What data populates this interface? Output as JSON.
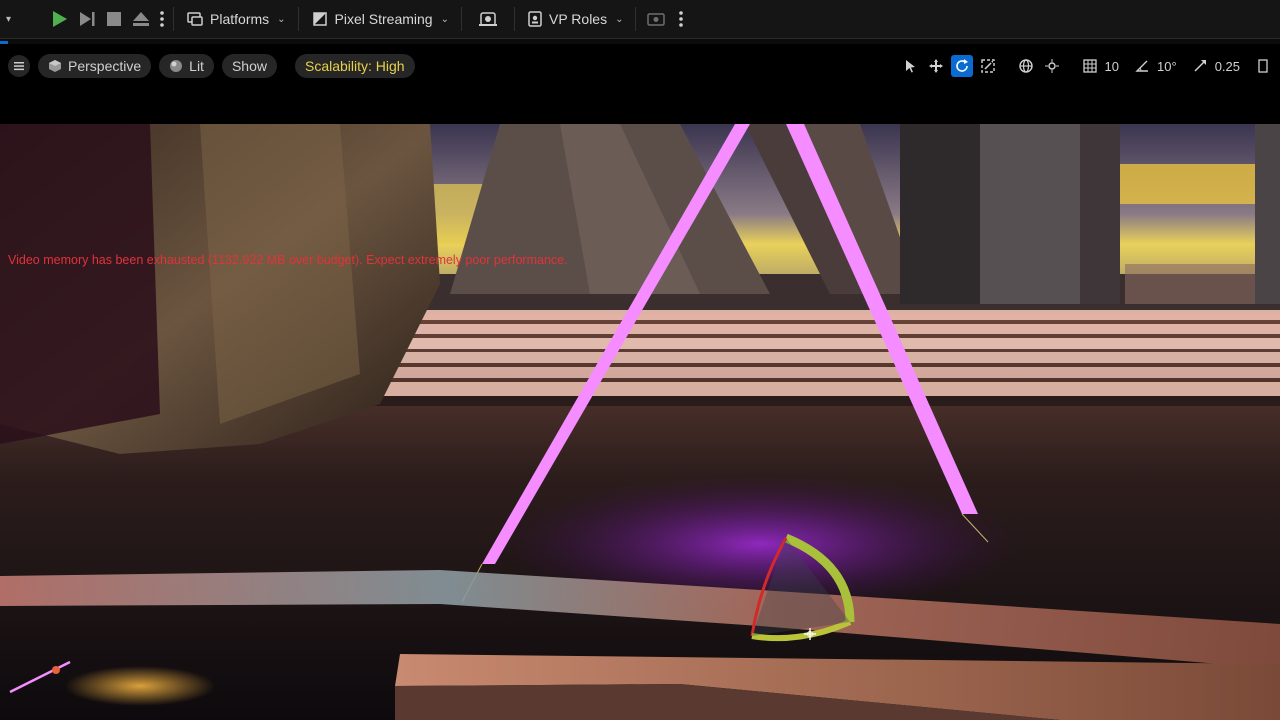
{
  "toolbar": {
    "platforms_label": "Platforms",
    "pixel_streaming_label": "Pixel Streaming",
    "vp_roles_label": "VP Roles"
  },
  "viewport_bar": {
    "perspective_label": "Perspective",
    "lit_label": "Lit",
    "show_label": "Show",
    "scalability_label": "Scalability: High",
    "grid_value": "10",
    "angle_value": "10°",
    "scale_value": "0.25"
  },
  "viewport": {
    "warning": "Video memory has been exhausted (1132.922 MB over budget). Expect extremely poor performance."
  },
  "colors": {
    "accent": "#0a6bd1",
    "play": "#4fb04f",
    "warning_text": "#e0333a",
    "scalability_text": "#e8d04a",
    "neon_pink": "#f58cff"
  }
}
